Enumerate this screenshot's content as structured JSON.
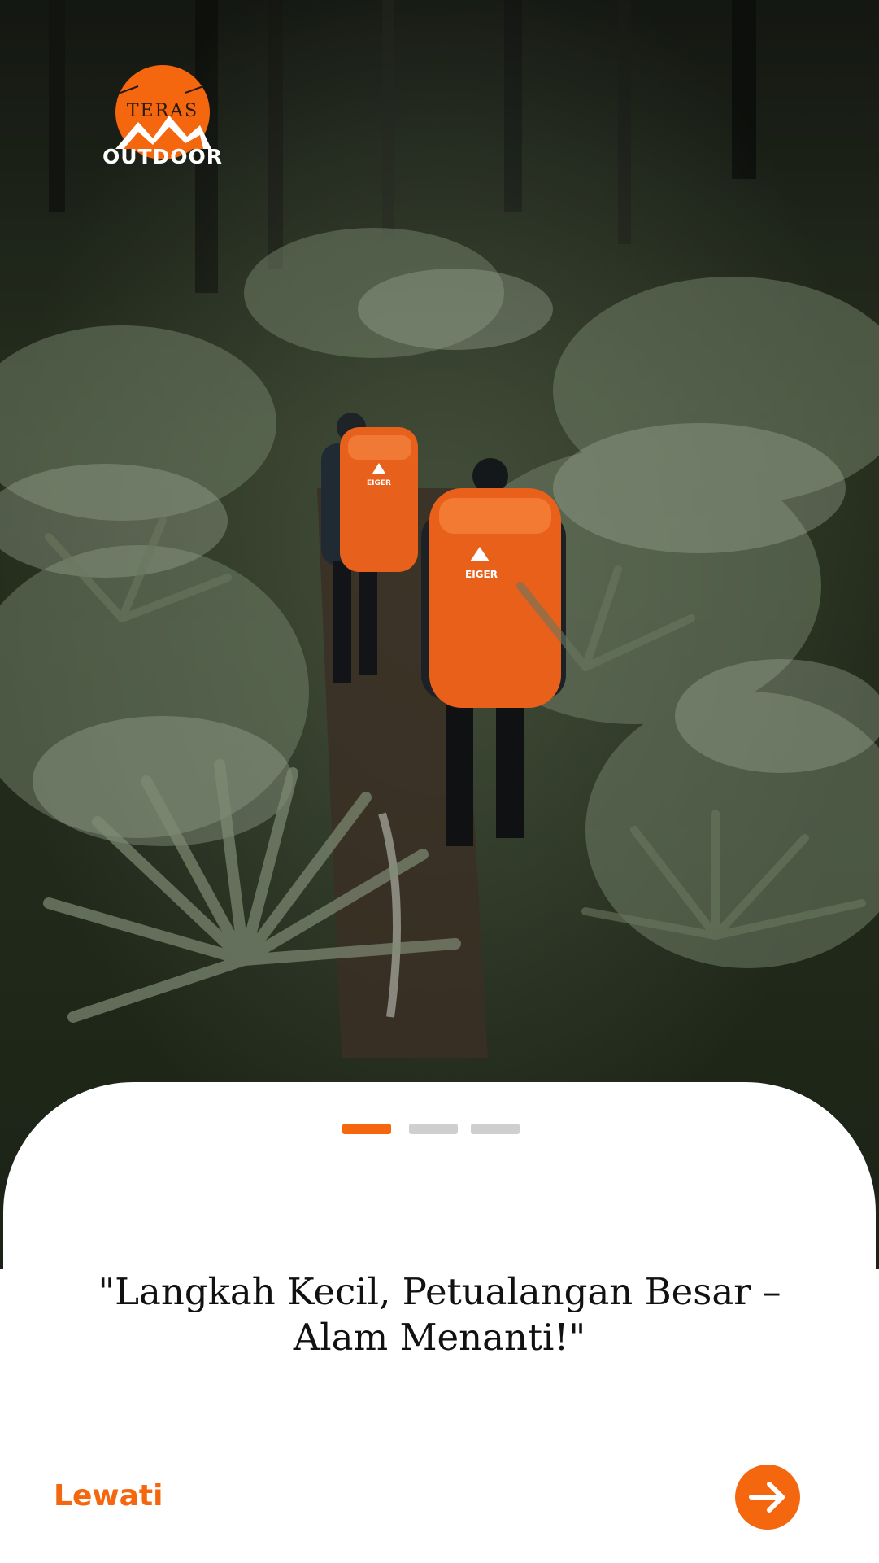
{
  "hero": {
    "backpack_brand": "EIGER"
  },
  "logo": {
    "script_text": "TERAS",
    "word_text": "OUTDOOR"
  },
  "onboarding": {
    "tagline": "\"Langkah Kecil, Petualangan Besar – Alam Menanti!\"",
    "page_count": 3,
    "current_page": 1
  },
  "actions": {
    "skip_label": "Lewati",
    "next_icon": "arrow-right-icon"
  },
  "colors": {
    "accent": "#f4670f",
    "inactive_dot": "#cfcfcf",
    "text": "#111111"
  }
}
